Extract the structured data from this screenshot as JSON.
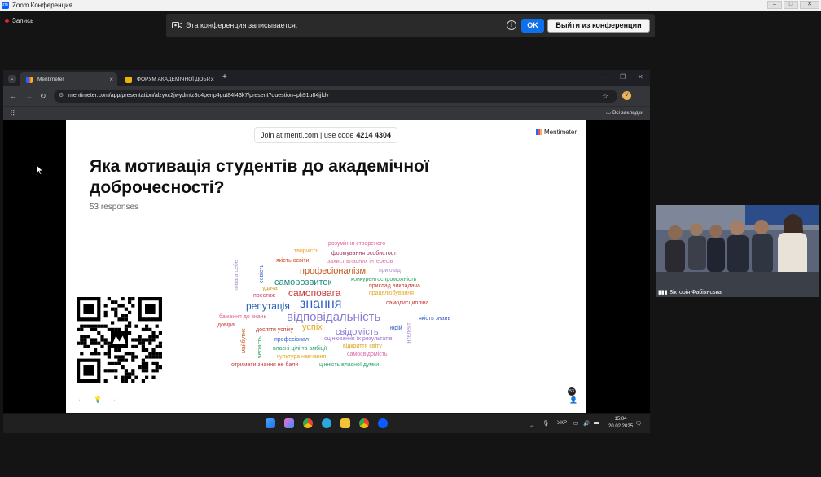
{
  "zoom": {
    "window_title": "Zoom Конференция",
    "recording_label": "Запись",
    "banner_message": "Эта конференция записывается.",
    "ok_label": "OK",
    "leave_label": "Выйти из конференции"
  },
  "browser": {
    "tabs": [
      {
        "label": "Mentimeter",
        "close": "×"
      },
      {
        "label": "ФОРУМ АКАДЕМІЧНОЇ ДОБР...",
        "close": "×"
      }
    ],
    "new_tab": "+",
    "url": "mentimeter.com/app/presentation/alzyxc2jwydmtz8u4penp4gut84f43k7/present?question=ph91u84jjfdv",
    "bookmarks_all": "Всі закладки",
    "avatar_letter": "V"
  },
  "slide": {
    "join_text": "Join at menti.com | use code",
    "join_code": "4214 4304",
    "brand": "Mentimeter",
    "question": "Яка мотивація студентів до академічної доброчесності?",
    "responses": "53 responses",
    "response_count": "53",
    "nav_prev": "←",
    "nav_hint": "💡",
    "nav_next": "→",
    "words": [
      {
        "t": "розуміння створеного",
        "c": "#e05c9a"
      },
      {
        "t": "творчість",
        "c": "#f0a020"
      },
      {
        "t": "формування особистості",
        "c": "#9b2b5a"
      },
      {
        "t": "якість освіти",
        "c": "#d24a1e"
      },
      {
        "t": "захист власних інтересів",
        "c": "#d96aa8"
      },
      {
        "t": "професіоналізм",
        "c": "#c2571b"
      },
      {
        "t": "приклад",
        "c": "#a88fd0"
      },
      {
        "t": "конкурентоспроможність",
        "c": "#2fa062"
      },
      {
        "t": "саморозвиток",
        "c": "#1f8b82"
      },
      {
        "t": "приклад викладача",
        "c": "#c0392b"
      },
      {
        "t": "удача",
        "c": "#d09a1a"
      },
      {
        "t": "самоповага",
        "c": "#c93535"
      },
      {
        "t": "працелюбування",
        "c": "#e6a72a"
      },
      {
        "t": "престиж",
        "c": "#d43b6e"
      },
      {
        "t": "репутація",
        "c": "#2561b5"
      },
      {
        "t": "знання",
        "c": "#2f5fc9"
      },
      {
        "t": "самодисципліна",
        "c": "#c93535"
      },
      {
        "t": "бажання до знань",
        "c": "#e0608e"
      },
      {
        "t": "відповідальність",
        "c": "#8a7bd6"
      },
      {
        "t": "якість знань",
        "c": "#3a63c4"
      },
      {
        "t": "довіра",
        "c": "#c73c3c"
      },
      {
        "t": "успіх",
        "c": "#e3a61a"
      },
      {
        "t": "юрій",
        "c": "#2c56b0"
      },
      {
        "t": "досягти успіху",
        "c": "#c0392b"
      },
      {
        "t": "свідомість",
        "c": "#8a7bd6"
      },
      {
        "t": "професіонал",
        "c": "#3a63c4"
      },
      {
        "t": "оцінювання їх результатів",
        "c": "#9a6fd0"
      },
      {
        "t": "власні цілі та амбіції",
        "c": "#29a36a"
      },
      {
        "t": "відкриття світу",
        "c": "#d4a21a"
      },
      {
        "t": "культура навчання",
        "c": "#e3a61a"
      },
      {
        "t": "самосвідомість",
        "c": "#d96aa8"
      },
      {
        "t": "отримати знання не бали",
        "c": "#c93535"
      },
      {
        "t": "цінність власної думки",
        "c": "#29a36a"
      },
      {
        "t": "повага себе",
        "c": "#a88fd0"
      },
      {
        "t": "совість",
        "c": "#3a63c4"
      },
      {
        "t": "майбутнє",
        "c": "#c2571b"
      },
      {
        "t": "чесність",
        "c": "#2fa062"
      },
      {
        "t": "інтелект",
        "c": "#a88fd0"
      }
    ]
  },
  "video": {
    "participant_name": "Вікторія Фабіянська"
  },
  "taskbar": {
    "language": "УКР",
    "time": "15:04",
    "date": "20.02.2025"
  }
}
